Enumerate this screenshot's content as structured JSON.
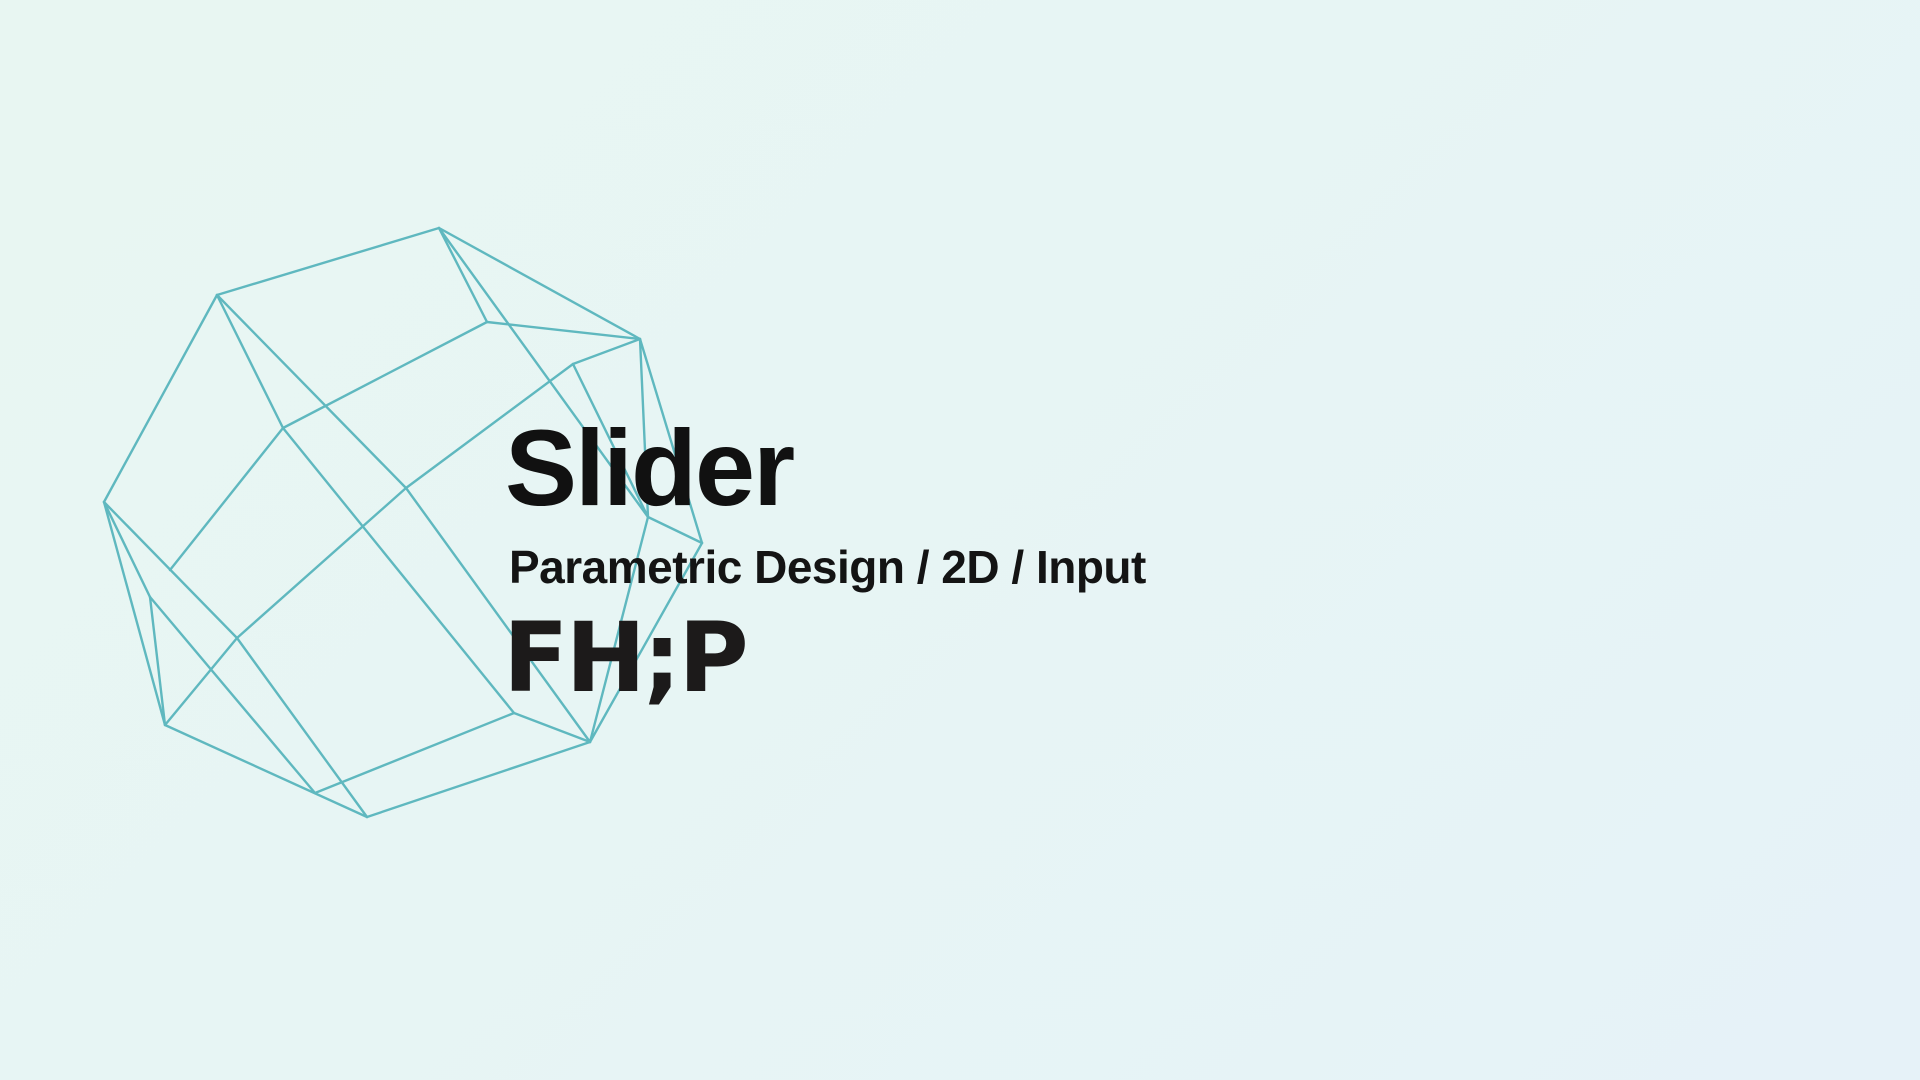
{
  "slide": {
    "title": "Slider",
    "subtitle": "Parametric Design / 2D / Input",
    "logo_text": "FH;P"
  },
  "wireframe": {
    "stroke_color": "#5fb8bf",
    "shape": "polyhedron-wireframe-icon"
  },
  "colors": {
    "background_start": "#e8f6f2",
    "background_end": "#e6f2f8",
    "text": "#111111"
  }
}
